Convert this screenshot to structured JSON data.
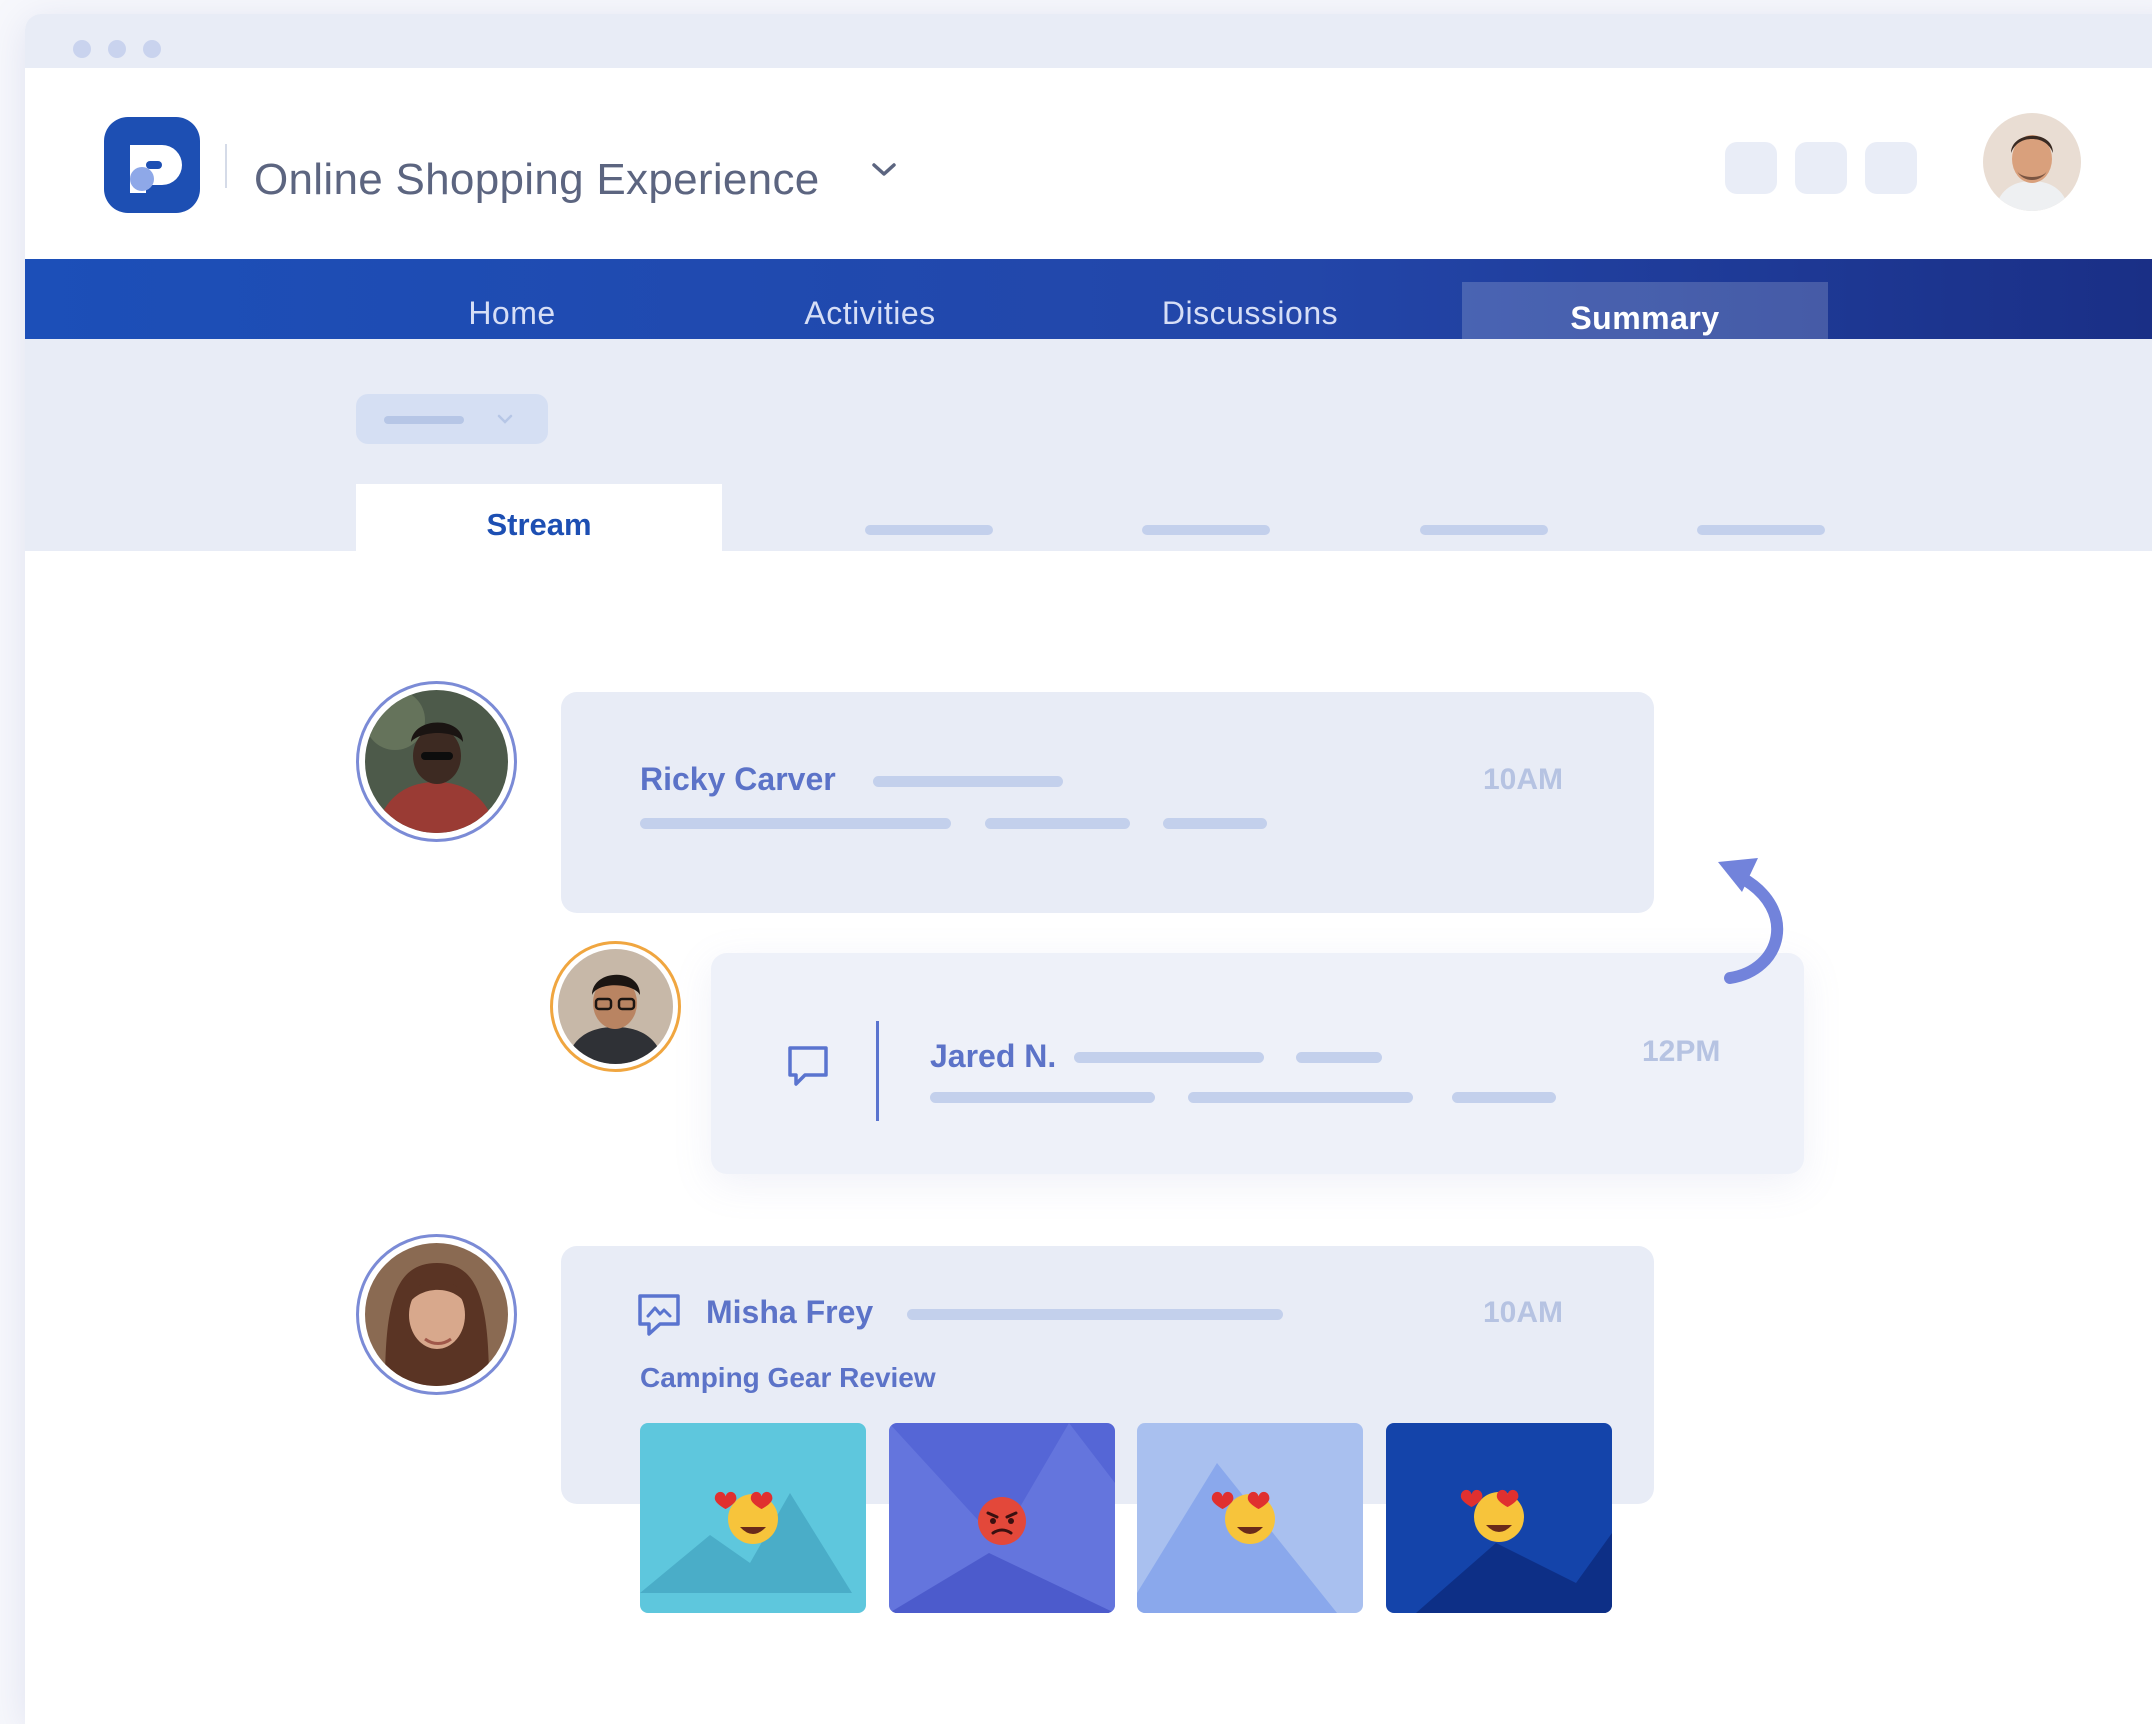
{
  "app": {
    "project_title": "Online Shopping Experience",
    "logo_icon": "app-logo-icon",
    "brand_color": "#1d4fb3",
    "accent_color": "#5c73c8"
  },
  "nav": {
    "items": [
      {
        "label": "Home"
      },
      {
        "label": "Activities"
      },
      {
        "label": "Discussions"
      },
      {
        "label": "Summary",
        "active": true
      }
    ]
  },
  "subnav": {
    "active_tab": "Stream"
  },
  "stream": {
    "posts": [
      {
        "author": "Ricky Carver",
        "time": "10AM",
        "avatar_ring": "#7b8bd6"
      },
      {
        "author": "Jared N.",
        "time": "12PM",
        "icon": "comment-icon",
        "avatar_ring": "#f0a640"
      },
      {
        "author": "Misha Frey",
        "time": "10AM",
        "icon": "chat-icon",
        "subtitle": "Camping Gear Review",
        "avatar_ring": "#7b8bd6",
        "images": [
          {
            "bg": "#5ec7dd",
            "reaction": "heart-eyes-emoji"
          },
          {
            "bg": "#5566d6",
            "reaction": "angry-face-emoji"
          },
          {
            "bg": "#a9c0ef",
            "reaction": "heart-eyes-emoji"
          },
          {
            "bg": "#1444aa",
            "reaction": "heart-eyes-emoji"
          }
        ]
      }
    ]
  },
  "icons": {
    "reply_arrow": "reply-arrow-icon",
    "dropdown": "chevron-down-icon"
  }
}
